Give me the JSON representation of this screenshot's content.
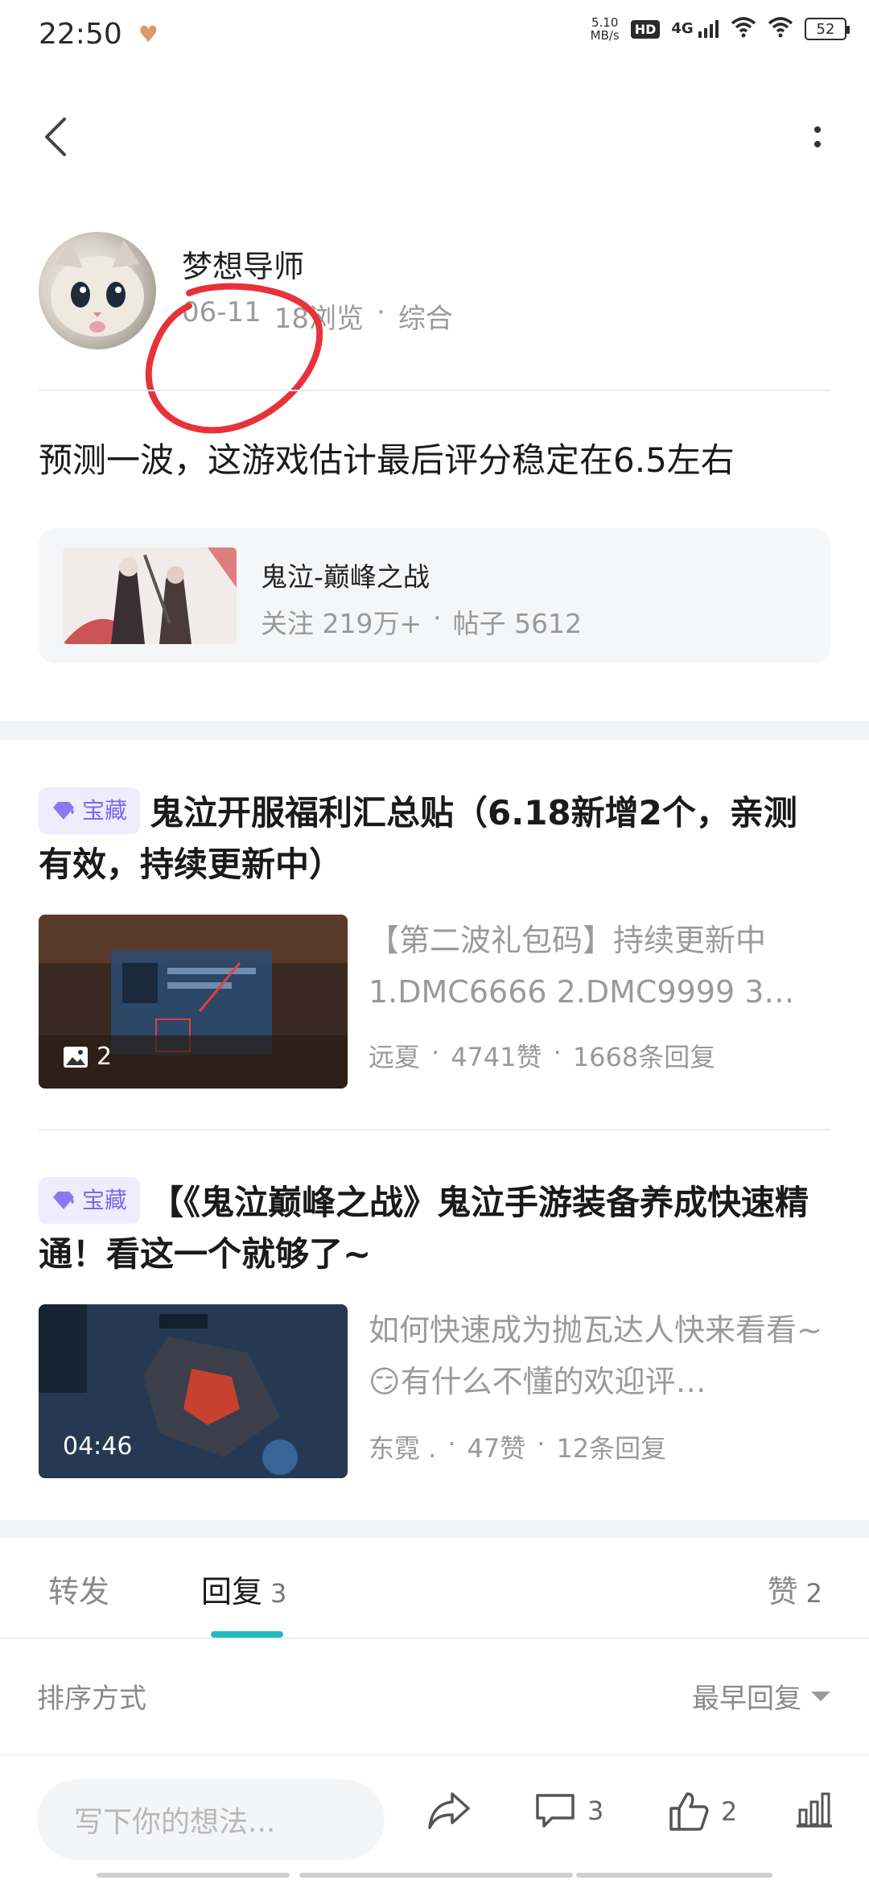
{
  "status_bar": {
    "time": "22:50",
    "net_speed_value": "5.10",
    "net_speed_unit": "MB/s",
    "hd": "HD",
    "network": "4G",
    "battery": "52"
  },
  "author": {
    "name": "梦想导师",
    "date": "06-11",
    "views": "18浏览",
    "separator": "·",
    "category": "综合"
  },
  "post": {
    "body": "预测一波，这游戏估计最后评分稳定在6.5左右"
  },
  "game_card": {
    "name": "鬼泣-巅峰之战",
    "follow": "关注 219万+",
    "separator": "·",
    "posts": "帖子 5612"
  },
  "recommended": [
    {
      "tag": "宝藏",
      "title": "鬼泣开服福利汇总贴（6.18新增2个，亲测有效，持续更新中）",
      "excerpt": "【第二波礼包码】持续更新中 1.DMC6666 2.DMC9999 3…",
      "thumb_badge": "2",
      "author": "远夏",
      "likes": "4741赞",
      "replies": "1668条回复",
      "separator": "·"
    },
    {
      "tag": "宝藏",
      "title": "【《鬼泣巅峰之战》鬼泣手游装备养成快速精通！看这一个就够了~",
      "excerpt": "如何快速成为抛瓦达人快来看看~😏有什么不懂的欢迎评…",
      "thumb_badge": "04:46",
      "author": "东霓 .",
      "likes": "47赞",
      "replies": "12条回复",
      "separator": "·"
    }
  ],
  "tabs": {
    "repost": "转发",
    "reply": "回复",
    "reply_count": "3",
    "like": "赞",
    "like_count": "2"
  },
  "sort": {
    "label": "排序方式",
    "value": "最早回复"
  },
  "bottom_bar": {
    "input_placeholder": "写下你的想法...",
    "comment_count": "3",
    "like_count": "2"
  },
  "colors": {
    "accent": "#1fb8c4",
    "tag_bg": "#f0ecff",
    "tag_text": "#7b6ae6",
    "annotation_red": "#e8323a"
  }
}
